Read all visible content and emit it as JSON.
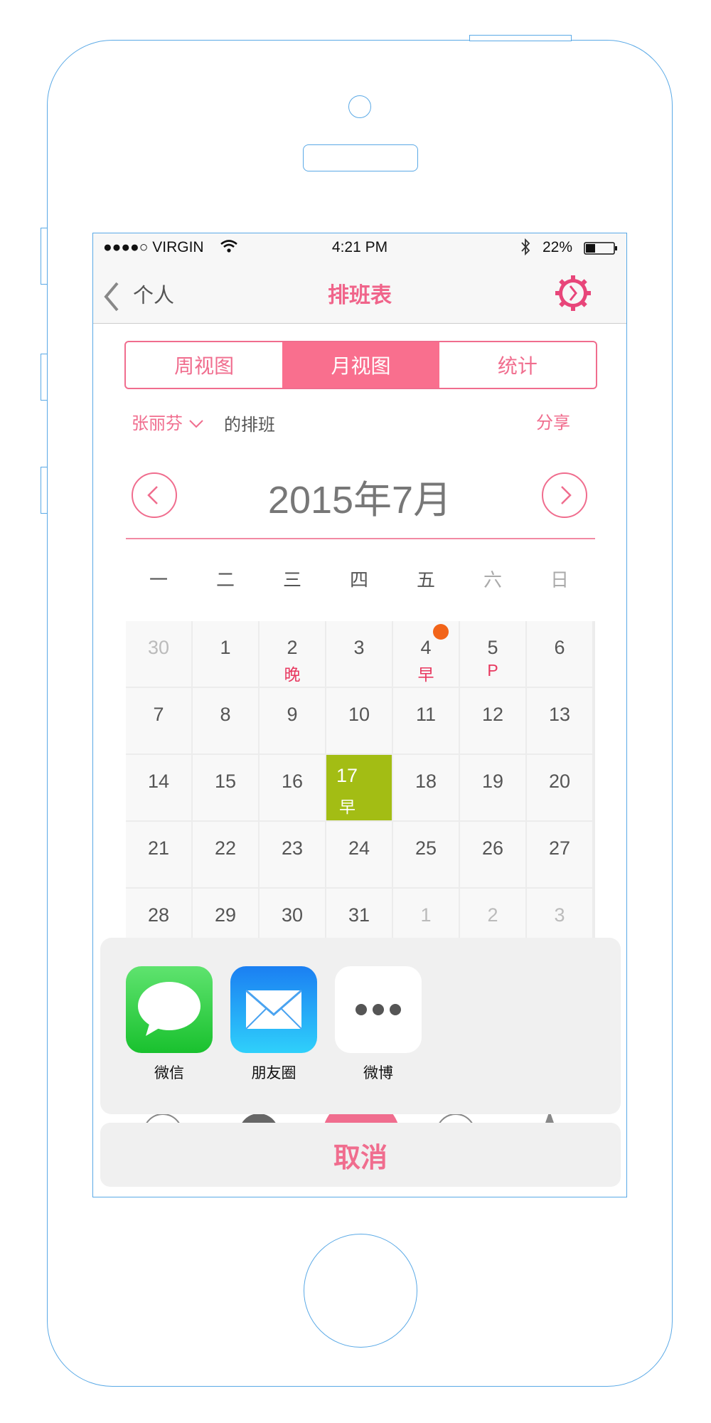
{
  "status_bar": {
    "carrier": "●●●●○ VIRGIN",
    "time": "4:21 PM",
    "battery_percent": "22%",
    "battery_level": 0.22
  },
  "nav": {
    "back_label": "个人",
    "title": "排班表",
    "settings_icon": "gear-clock-icon"
  },
  "segments": [
    {
      "label": "周视图",
      "active": false
    },
    {
      "label": "月视图",
      "active": true
    },
    {
      "label": "统计",
      "active": false
    }
  ],
  "schedule_owner": {
    "name": "张丽芬",
    "suffix": "的排班",
    "share_label": "分享"
  },
  "month": {
    "title": "2015年7月",
    "weekdays": [
      "一",
      "二",
      "三",
      "四",
      "五",
      "六",
      "日"
    ],
    "days": [
      {
        "n": "30",
        "muted": true
      },
      {
        "n": "1"
      },
      {
        "n": "2",
        "shift": "晚"
      },
      {
        "n": "3"
      },
      {
        "n": "4",
        "shift": "早",
        "dot": true
      },
      {
        "n": "5",
        "shift": "P"
      },
      {
        "n": "6"
      },
      {
        "n": "7"
      },
      {
        "n": "8"
      },
      {
        "n": "9"
      },
      {
        "n": "10"
      },
      {
        "n": "11"
      },
      {
        "n": "12"
      },
      {
        "n": "13"
      },
      {
        "n": "14"
      },
      {
        "n": "15"
      },
      {
        "n": "16"
      },
      {
        "n": "17",
        "shift": "早",
        "today": true
      },
      {
        "n": "18"
      },
      {
        "n": "19"
      },
      {
        "n": "20"
      },
      {
        "n": "21"
      },
      {
        "n": "22"
      },
      {
        "n": "23"
      },
      {
        "n": "24"
      },
      {
        "n": "25"
      },
      {
        "n": "26"
      },
      {
        "n": "27"
      },
      {
        "n": "28"
      },
      {
        "n": "29"
      },
      {
        "n": "30"
      },
      {
        "n": "31"
      },
      {
        "n": "1",
        "muted": true
      },
      {
        "n": "2",
        "muted": true
      },
      {
        "n": "3",
        "muted": true
      }
    ]
  },
  "share_sheet": {
    "items": [
      {
        "label": "微信",
        "icon": "messages-icon"
      },
      {
        "label": "朋友圈",
        "icon": "mail-icon"
      },
      {
        "label": "微博",
        "icon": "more-icon"
      }
    ],
    "cancel_label": "取消"
  },
  "colors": {
    "accent": "#f06d8e",
    "today": "#a3bd14",
    "notification_dot": "#f26419",
    "frame": "#5aa9e6"
  }
}
